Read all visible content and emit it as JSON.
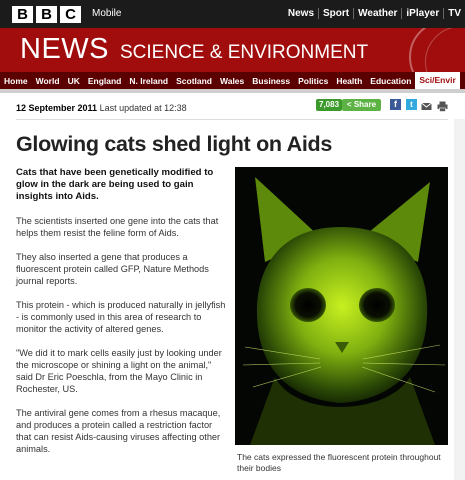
{
  "header": {
    "logo_letters": [
      "B",
      "B",
      "C"
    ],
    "mobile_label": "Mobile",
    "global_nav": [
      "News",
      "Sport",
      "Weather",
      "iPlayer",
      "TV"
    ]
  },
  "banner": {
    "news": "NEWS",
    "section": "SCIENCE & ENVIRONMENT",
    "brand_color": "#a10d0d"
  },
  "subnav": {
    "items": [
      "Home",
      "World",
      "UK",
      "England",
      "N. Ireland",
      "Scotland",
      "Wales",
      "Business",
      "Politics",
      "Health",
      "Education",
      "Sci/Envir"
    ],
    "active_index": 11
  },
  "article": {
    "date": "12 September 2011",
    "updated": "Last updated at 12:38",
    "share_count": "7,083",
    "share_label": "Share",
    "share_icons": [
      "facebook-icon",
      "twitter-icon",
      "email-icon",
      "print-icon"
    ],
    "headline": "Glowing cats shed light on Aids",
    "paragraphs": [
      "Cats that have been genetically modified to glow in the dark are being used to gain insights into Aids.",
      "The scientists inserted one gene into the cats that helps them resist the feline form of Aids.",
      "They also inserted a gene that produces a fluorescent protein called GFP, Nature Methods journal reports.",
      "This protein - which is produced naturally in jellyfish - is commonly used in this area of research to monitor the activity of altered genes.",
      "\"We did it to mark cells easily just by looking under the microscope or shining a light on the animal,\" said Dr Eric Poeschla, from the Mayo Clinic in Rochester, US.",
      "The antiviral gene comes from a rhesus macaque, and produces a protein called a restriction factor that can resist Aids-causing viruses affecting other animals."
    ],
    "caption": "The cats expressed the fluorescent protein throughout their bodies"
  }
}
